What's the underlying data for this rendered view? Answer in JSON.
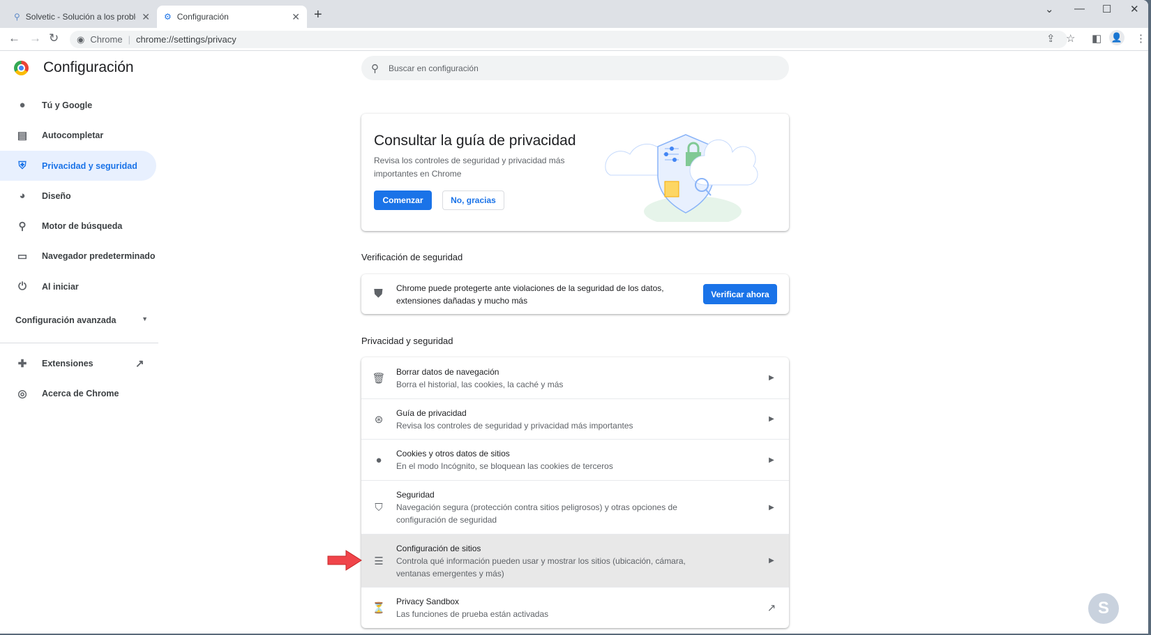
{
  "browser": {
    "tabs": [
      {
        "title": "Solvetic - Solución a los problemas",
        "icon": "solvetic-icon",
        "active": false
      },
      {
        "title": "Configuración",
        "icon": "gear-icon",
        "active": true
      }
    ],
    "omnibox": {
      "origin": "Chrome",
      "url": "chrome://settings/privacy"
    }
  },
  "header": {
    "title": "Configuración"
  },
  "search": {
    "placeholder": "Buscar en configuración"
  },
  "sidebar": {
    "items": [
      {
        "label": "Tú y Google",
        "icon": "person-icon"
      },
      {
        "label": "Autocompletar",
        "icon": "clipboard-icon"
      },
      {
        "label": "Privacidad y seguridad",
        "icon": "shield-icon",
        "active": true
      },
      {
        "label": "Diseño",
        "icon": "palette-icon"
      },
      {
        "label": "Motor de búsqueda",
        "icon": "search-icon"
      },
      {
        "label": "Navegador predeterminado",
        "icon": "browser-icon"
      },
      {
        "label": "Al iniciar",
        "icon": "power-icon"
      }
    ],
    "advanced": "Configuración avanzada",
    "extensions": "Extensiones",
    "about": "Acerca de Chrome"
  },
  "privacy_guide_card": {
    "title": "Consultar la guía de privacidad",
    "description": "Revisa los controles de seguridad y privacidad más importantes en Chrome",
    "start_label": "Comenzar",
    "dismiss_label": "No, gracias"
  },
  "safety_check": {
    "section_title": "Verificación de seguridad",
    "text": "Chrome puede protegerte ante violaciones de la seguridad de los datos, extensiones dañadas y mucho más",
    "button_label": "Verificar ahora"
  },
  "privacy": {
    "section_title": "Privacidad y seguridad",
    "rows": [
      {
        "title": "Borrar datos de navegación",
        "subtitle": "Borra el historial, las cookies, la caché y más",
        "icon": "trash-icon"
      },
      {
        "title": "Guía de privacidad",
        "subtitle": "Revisa los controles de seguridad y privacidad más importantes",
        "icon": "compass-icon"
      },
      {
        "title": "Cookies y otros datos de sitios",
        "subtitle": "En el modo Incógnito, se bloquean las cookies de terceros",
        "icon": "cookie-icon"
      },
      {
        "title": "Seguridad",
        "subtitle": "Navegación segura (protección contra sitios peligrosos) y otras opciones de configuración de seguridad",
        "icon": "security-shield-icon"
      },
      {
        "title": "Configuración de sitios",
        "subtitle": "Controla qué información pueden usar y mostrar los sitios (ubicación, cámara, ventanas emergentes y más)",
        "icon": "tune-icon",
        "highlighted": true
      },
      {
        "title": "Privacy Sandbox",
        "subtitle": "Las funciones de prueba están activadas",
        "icon": "flask-icon"
      }
    ]
  },
  "colors": {
    "accent": "#1a73e8",
    "highlight_arrow": "#f0444a",
    "active_bg": "#e8f0fe"
  }
}
